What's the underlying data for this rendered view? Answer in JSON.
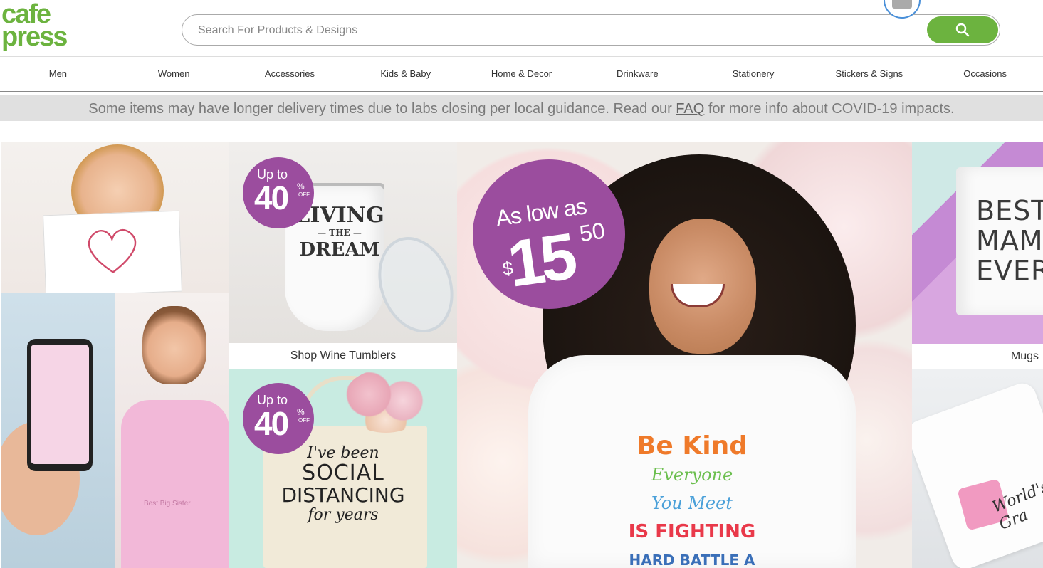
{
  "header": {
    "logo_line1": "cafe",
    "logo_line2": "press",
    "search_placeholder": "Search For Products & Designs",
    "search_icon": "search-icon",
    "accent_color": "#6cb33f"
  },
  "nav": {
    "items": [
      "Men",
      "Women",
      "Accessories",
      "Kids & Baby",
      "Home & Decor",
      "Drinkware",
      "Stationery",
      "Stickers & Signs",
      "Occasions"
    ]
  },
  "banner": {
    "text_before": "Some items may have longer delivery times due to labs closing per local guidance. Read our ",
    "link": "FAQ",
    "text_after": " for more info about COVID-19 impacts."
  },
  "tiles": {
    "kid_shirt_caption": "Best Big Sister",
    "tumbler": {
      "promo_up": "Up to",
      "promo_num": "40",
      "promo_pct": "%",
      "promo_off": "OFF",
      "text_line1": "LIVING",
      "text_line2": "— THE —",
      "text_line3": "DREAM",
      "caption": "Shop Wine Tumblers"
    },
    "tote": {
      "promo_up": "Up to",
      "promo_num": "40",
      "promo_pct": "%",
      "promo_off": "OFF",
      "line1": "I've been",
      "line2": "SOCIAL",
      "line3": "DISTANCING",
      "line4": "for years"
    },
    "hero": {
      "promo_as_low_as": "As low as",
      "promo_currency": "$",
      "promo_whole": "15",
      "promo_cents": "50",
      "shirt_line1": "Be Kind",
      "shirt_line2": "Everyone",
      "shirt_line3": "You Meet",
      "shirt_line4": "IS FIGHTING",
      "shirt_line5": "HARD BATTLE A"
    },
    "mug": {
      "text_line1": "BEST.",
      "text_line2": "MAM",
      "text_line3": "EVER.",
      "caption": "Mugs"
    },
    "gran": {
      "text_line1": "World's",
      "text_line2": "Gra"
    }
  }
}
